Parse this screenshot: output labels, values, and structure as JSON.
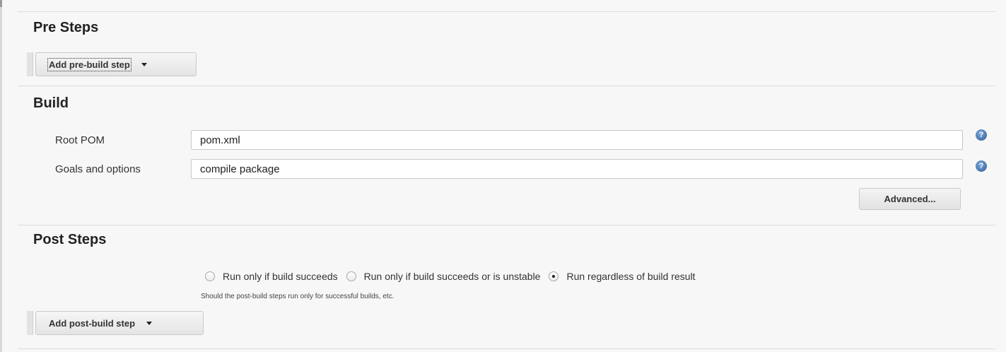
{
  "pre_steps": {
    "title": "Pre Steps",
    "add_button_label": "Add pre-build step"
  },
  "build": {
    "title": "Build",
    "root_pom_label": "Root POM",
    "root_pom_value": "pom.xml",
    "goals_label": "Goals and options",
    "goals_value": "compile package",
    "advanced_label": "Advanced..."
  },
  "post_steps": {
    "title": "Post Steps",
    "options": [
      {
        "label": "Run only if build succeeds",
        "checked": false
      },
      {
        "label": "Run only if build succeeds or is unstable",
        "checked": false
      },
      {
        "label": "Run regardless of build result",
        "checked": true
      }
    ],
    "hint": "Should the post-build steps run only for successful builds, etc.",
    "add_button_label": "Add post-build step"
  },
  "icons": {
    "help": "help-icon",
    "dropdown": "chevron-down-icon"
  },
  "colors": {
    "background": "#f7f7f7",
    "help_icon": "#3b6eb0"
  }
}
